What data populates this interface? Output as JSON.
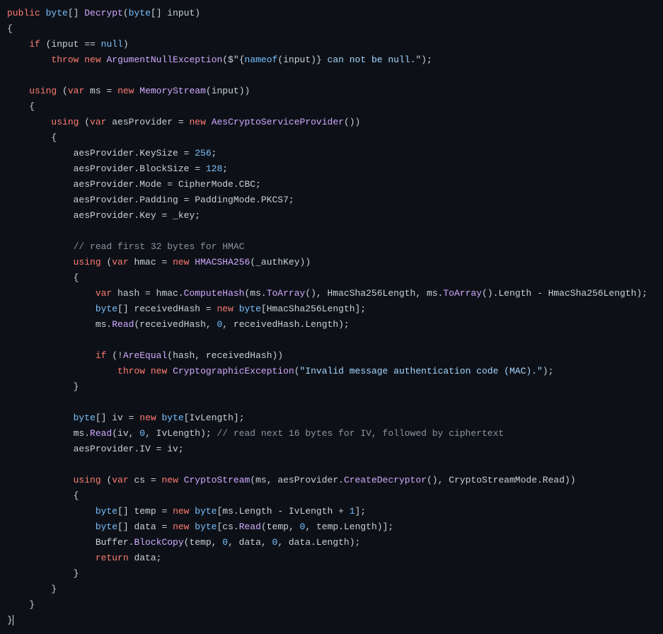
{
  "language": "csharp",
  "code_tokens": [
    [
      [
        "kw",
        "public"
      ],
      [
        "p",
        " "
      ],
      [
        "builtin",
        "byte"
      ],
      [
        "p",
        "[] "
      ],
      [
        "func",
        "Decrypt"
      ],
      [
        "p",
        "("
      ],
      [
        "builtin",
        "byte"
      ],
      [
        "p",
        "[] input)"
      ]
    ],
    [
      [
        "p",
        "{"
      ]
    ],
    [
      [
        "p",
        "    "
      ],
      [
        "kw",
        "if"
      ],
      [
        "p",
        " (input == "
      ],
      [
        "builtin",
        "null"
      ],
      [
        "p",
        ")"
      ]
    ],
    [
      [
        "p",
        "        "
      ],
      [
        "kw",
        "throw"
      ],
      [
        "p",
        " "
      ],
      [
        "kw",
        "new"
      ],
      [
        "p",
        " "
      ],
      [
        "func",
        "ArgumentNullException"
      ],
      [
        "p",
        "($\""
      ],
      [
        "p",
        "{"
      ],
      [
        "builtin",
        "nameof"
      ],
      [
        "p",
        "(input)} "
      ],
      [
        "str",
        "can not be null."
      ],
      [
        "p",
        "\");"
      ]
    ],
    [
      [
        "p",
        ""
      ]
    ],
    [
      [
        "p",
        "    "
      ],
      [
        "kw",
        "using"
      ],
      [
        "p",
        " ("
      ],
      [
        "kw",
        "var"
      ],
      [
        "p",
        " ms = "
      ],
      [
        "kw",
        "new"
      ],
      [
        "p",
        " "
      ],
      [
        "func",
        "MemoryStream"
      ],
      [
        "p",
        "(input))"
      ]
    ],
    [
      [
        "p",
        "    {"
      ]
    ],
    [
      [
        "p",
        "        "
      ],
      [
        "kw",
        "using"
      ],
      [
        "p",
        " ("
      ],
      [
        "kw",
        "var"
      ],
      [
        "p",
        " aesProvider = "
      ],
      [
        "kw",
        "new"
      ],
      [
        "p",
        " "
      ],
      [
        "func",
        "AesCryptoServiceProvider"
      ],
      [
        "p",
        "())"
      ]
    ],
    [
      [
        "p",
        "        {"
      ]
    ],
    [
      [
        "p",
        "            aesProvider.KeySize = "
      ],
      [
        "num",
        "256"
      ],
      [
        "p",
        ";"
      ]
    ],
    [
      [
        "p",
        "            aesProvider.BlockSize = "
      ],
      [
        "num",
        "128"
      ],
      [
        "p",
        ";"
      ]
    ],
    [
      [
        "p",
        "            aesProvider.Mode = CipherMode.CBC;"
      ]
    ],
    [
      [
        "p",
        "            aesProvider.Padding = PaddingMode.PKCS7;"
      ]
    ],
    [
      [
        "p",
        "            aesProvider.Key = _key;"
      ]
    ],
    [
      [
        "p",
        ""
      ]
    ],
    [
      [
        "p",
        "            "
      ],
      [
        "comment",
        "// read first 32 bytes for HMAC"
      ]
    ],
    [
      [
        "p",
        "            "
      ],
      [
        "kw",
        "using"
      ],
      [
        "p",
        " ("
      ],
      [
        "kw",
        "var"
      ],
      [
        "p",
        " hmac = "
      ],
      [
        "kw",
        "new"
      ],
      [
        "p",
        " "
      ],
      [
        "func",
        "HMACSHA256"
      ],
      [
        "p",
        "(_authKey))"
      ]
    ],
    [
      [
        "p",
        "            {"
      ]
    ],
    [
      [
        "p",
        "                "
      ],
      [
        "kw",
        "var"
      ],
      [
        "p",
        " hash = hmac."
      ],
      [
        "func",
        "ComputeHash"
      ],
      [
        "p",
        "(ms."
      ],
      [
        "func",
        "ToArray"
      ],
      [
        "p",
        "(), HmacSha256Length, ms."
      ],
      [
        "func",
        "ToArray"
      ],
      [
        "p",
        "().Length - HmacSha256Length);"
      ]
    ],
    [
      [
        "p",
        "                "
      ],
      [
        "builtin",
        "byte"
      ],
      [
        "p",
        "[] receivedHash = "
      ],
      [
        "kw",
        "new"
      ],
      [
        "p",
        " "
      ],
      [
        "builtin",
        "byte"
      ],
      [
        "p",
        "[HmacSha256Length];"
      ]
    ],
    [
      [
        "p",
        "                ms."
      ],
      [
        "func",
        "Read"
      ],
      [
        "p",
        "(receivedHash, "
      ],
      [
        "num",
        "0"
      ],
      [
        "p",
        ", receivedHash.Length);"
      ]
    ],
    [
      [
        "p",
        ""
      ]
    ],
    [
      [
        "p",
        "                "
      ],
      [
        "kw",
        "if"
      ],
      [
        "p",
        " (!"
      ],
      [
        "func",
        "AreEqual"
      ],
      [
        "p",
        "(hash, receivedHash))"
      ]
    ],
    [
      [
        "p",
        "                    "
      ],
      [
        "kw",
        "throw"
      ],
      [
        "p",
        " "
      ],
      [
        "kw",
        "new"
      ],
      [
        "p",
        " "
      ],
      [
        "func",
        "CryptographicException"
      ],
      [
        "p",
        "("
      ],
      [
        "str",
        "\"Invalid message authentication code (MAC).\""
      ],
      [
        "p",
        ");"
      ]
    ],
    [
      [
        "p",
        "            }"
      ]
    ],
    [
      [
        "p",
        ""
      ]
    ],
    [
      [
        "p",
        "            "
      ],
      [
        "builtin",
        "byte"
      ],
      [
        "p",
        "[] iv = "
      ],
      [
        "kw",
        "new"
      ],
      [
        "p",
        " "
      ],
      [
        "builtin",
        "byte"
      ],
      [
        "p",
        "[IvLength];"
      ]
    ],
    [
      [
        "p",
        "            ms."
      ],
      [
        "func",
        "Read"
      ],
      [
        "p",
        "(iv, "
      ],
      [
        "num",
        "0"
      ],
      [
        "p",
        ", IvLength); "
      ],
      [
        "comment",
        "// read next 16 bytes for IV, followed by ciphertext"
      ]
    ],
    [
      [
        "p",
        "            aesProvider.IV = iv;"
      ]
    ],
    [
      [
        "p",
        ""
      ]
    ],
    [
      [
        "p",
        "            "
      ],
      [
        "kw",
        "using"
      ],
      [
        "p",
        " ("
      ],
      [
        "kw",
        "var"
      ],
      [
        "p",
        " cs = "
      ],
      [
        "kw",
        "new"
      ],
      [
        "p",
        " "
      ],
      [
        "func",
        "CryptoStream"
      ],
      [
        "p",
        "(ms, aesProvider."
      ],
      [
        "func",
        "CreateDecryptor"
      ],
      [
        "p",
        "(), CryptoStreamMode.Read))"
      ]
    ],
    [
      [
        "p",
        "            {"
      ]
    ],
    [
      [
        "p",
        "                "
      ],
      [
        "builtin",
        "byte"
      ],
      [
        "p",
        "[] temp = "
      ],
      [
        "kw",
        "new"
      ],
      [
        "p",
        " "
      ],
      [
        "builtin",
        "byte"
      ],
      [
        "p",
        "[ms.Length - IvLength + "
      ],
      [
        "num",
        "1"
      ],
      [
        "p",
        "];"
      ]
    ],
    [
      [
        "p",
        "                "
      ],
      [
        "builtin",
        "byte"
      ],
      [
        "p",
        "[] data = "
      ],
      [
        "kw",
        "new"
      ],
      [
        "p",
        " "
      ],
      [
        "builtin",
        "byte"
      ],
      [
        "p",
        "[cs."
      ],
      [
        "func",
        "Read"
      ],
      [
        "p",
        "(temp, "
      ],
      [
        "num",
        "0"
      ],
      [
        "p",
        ", temp.Length)];"
      ]
    ],
    [
      [
        "p",
        "                Buffer."
      ],
      [
        "func",
        "BlockCopy"
      ],
      [
        "p",
        "(temp, "
      ],
      [
        "num",
        "0"
      ],
      [
        "p",
        ", data, "
      ],
      [
        "num",
        "0"
      ],
      [
        "p",
        ", data.Length);"
      ]
    ],
    [
      [
        "p",
        "                "
      ],
      [
        "kw",
        "return"
      ],
      [
        "p",
        " data;"
      ]
    ],
    [
      [
        "p",
        "            }"
      ]
    ],
    [
      [
        "p",
        "        }"
      ]
    ],
    [
      [
        "p",
        "    }"
      ]
    ],
    [
      [
        "p",
        "}"
      ],
      [
        "cursor",
        ""
      ]
    ]
  ],
  "colors": {
    "background": "#0d1117",
    "default": "#c9d1d9",
    "keyword": "#ff7b72",
    "function": "#d2a8ff",
    "builtin": "#79c0ff",
    "number": "#79c0ff",
    "string": "#a5d6ff",
    "comment": "#8b949e"
  }
}
